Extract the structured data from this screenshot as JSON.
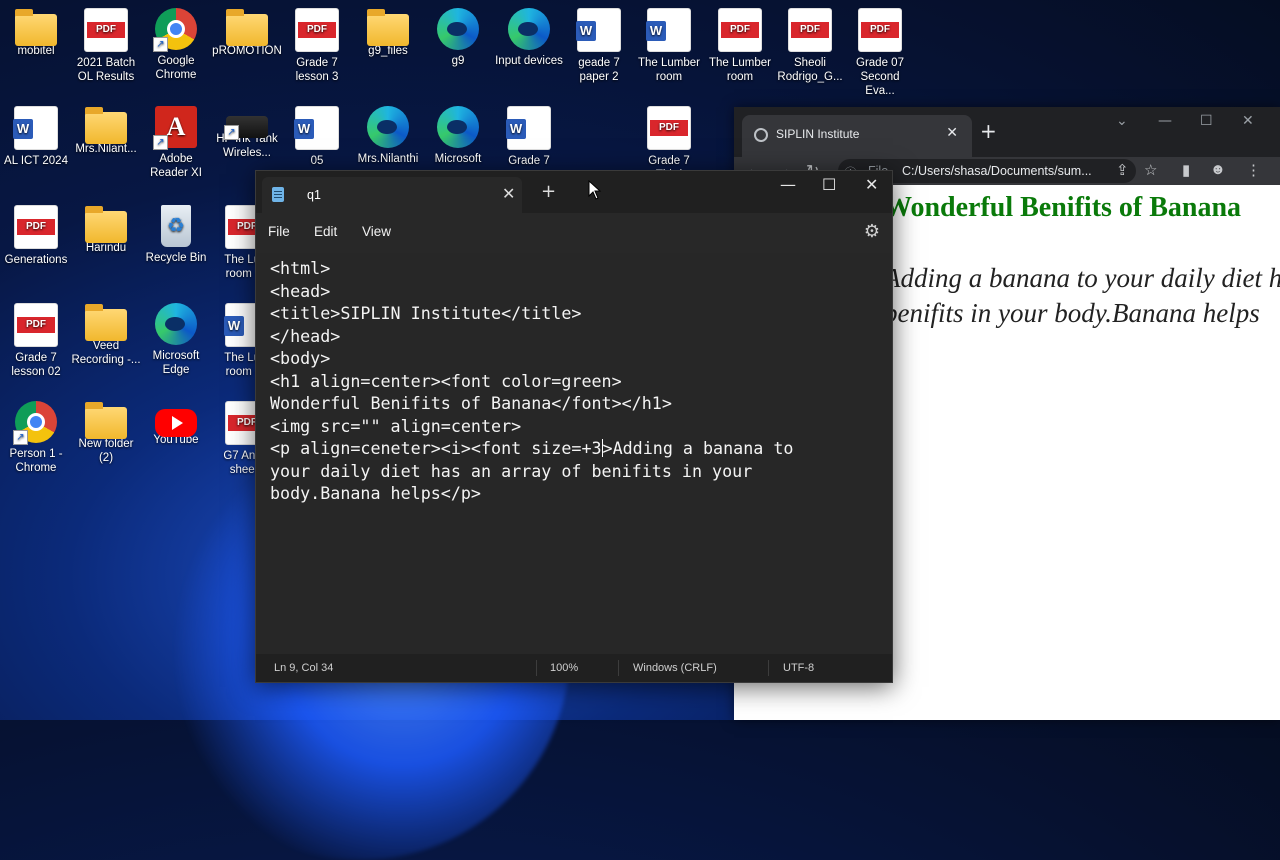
{
  "desktop": {
    "icons": [
      {
        "label": "mobitel",
        "icon": "folder-icon"
      },
      {
        "label": "2021 Batch OL Results",
        "icon": "pdf-icon"
      },
      {
        "label": "Google Chrome",
        "icon": "chrome-icon"
      },
      {
        "label": "pROMOTION",
        "icon": "folder-icon"
      },
      {
        "label": "Grade 7 lesson 3",
        "icon": "pdf-icon"
      },
      {
        "label": "g9_files",
        "icon": "folder-icon"
      },
      {
        "label": "g9",
        "icon": "edge-icon"
      },
      {
        "label": "Input devices",
        "icon": "edge-icon"
      },
      {
        "label": "geade 7 paper 2",
        "icon": "word-icon"
      },
      {
        "label": "The Lumber room",
        "icon": "word-icon"
      },
      {
        "label": "The Lumber room",
        "icon": "pdf-icon"
      },
      {
        "label": "Sheoli Rodrigo_G...",
        "icon": "pdf-icon"
      },
      {
        "label": "Grade 07 Second Eva...",
        "icon": "pdf-icon"
      },
      {
        "label": "AL ICT 2024",
        "icon": "word-icon"
      },
      {
        "label": "Mrs.Nilant...",
        "icon": "folder-icon"
      },
      {
        "label": "Adobe Reader XI",
        "icon": "acrobat-icon"
      },
      {
        "label": "HP Ink Tank Wireles...",
        "icon": "printer-icon"
      },
      {
        "label": "05",
        "icon": "word-icon"
      },
      {
        "label": "Mrs.Nilanthi",
        "icon": "edge-icon"
      },
      {
        "label": "Microsoft",
        "icon": "edge-icon"
      },
      {
        "label": "Grade 7",
        "icon": "word-icon"
      },
      {
        "label": "Grade 7 Third",
        "icon": "pdf-icon"
      },
      {
        "label": "Generations",
        "icon": "pdf-icon"
      },
      {
        "label": "Harindu",
        "icon": "folder-icon"
      },
      {
        "label": "Recycle Bin",
        "icon": "recycle-bin-icon"
      },
      {
        "label": "The Lu... room -...",
        "icon": "pdf-icon"
      },
      {
        "label": "Grade 7 lesson 02",
        "icon": "pdf-icon"
      },
      {
        "label": "Veed Recording -...",
        "icon": "folder-icon"
      },
      {
        "label": "Microsoft Edge",
        "icon": "edge-icon"
      },
      {
        "label": "The Lu... room -...",
        "icon": "word-icon"
      },
      {
        "label": "Person 1 - Chrome",
        "icon": "chrome-icon"
      },
      {
        "label": "New folder (2)",
        "icon": "folder-icon"
      },
      {
        "label": "YouTube",
        "icon": "youtube-icon"
      },
      {
        "label": "G7 Ans... shee...",
        "icon": "pdf-icon"
      }
    ]
  },
  "browser": {
    "tab_title": "SIPLIN Institute",
    "url_scheme": "File",
    "url": "C:/Users/shasa/Documents/sum...",
    "page_heading": "Wonderful Benifits of Banana",
    "page_paragraph": "Adding a banana to your daily diet has an array of benifits in your body.Banana helps",
    "heading_color": "#0a7a0a"
  },
  "notepad": {
    "tab_title": "q1",
    "menu": {
      "file": "File",
      "edit": "Edit",
      "view": "View"
    },
    "code_lines": [
      "<html>",
      "<head>",
      "<title>SIPLIN Institute</title>",
      "</head>",
      "<body>",
      "<h1 align=center><font color=green>",
      "Wonderful Benifits of Banana</font></h1>",
      "<img src=\"\" align=center>",
      "<p align=ceneter><i><font size=+3",
      "your daily diet has an array of benifits in your",
      "body.Banana helps</p>"
    ],
    "line9_after_caret": ">Adding a banana to",
    "status": {
      "position": "Ln 9, Col 34",
      "zoom": "100%",
      "line_ending": "Windows (CRLF)",
      "encoding": "UTF-8"
    }
  }
}
